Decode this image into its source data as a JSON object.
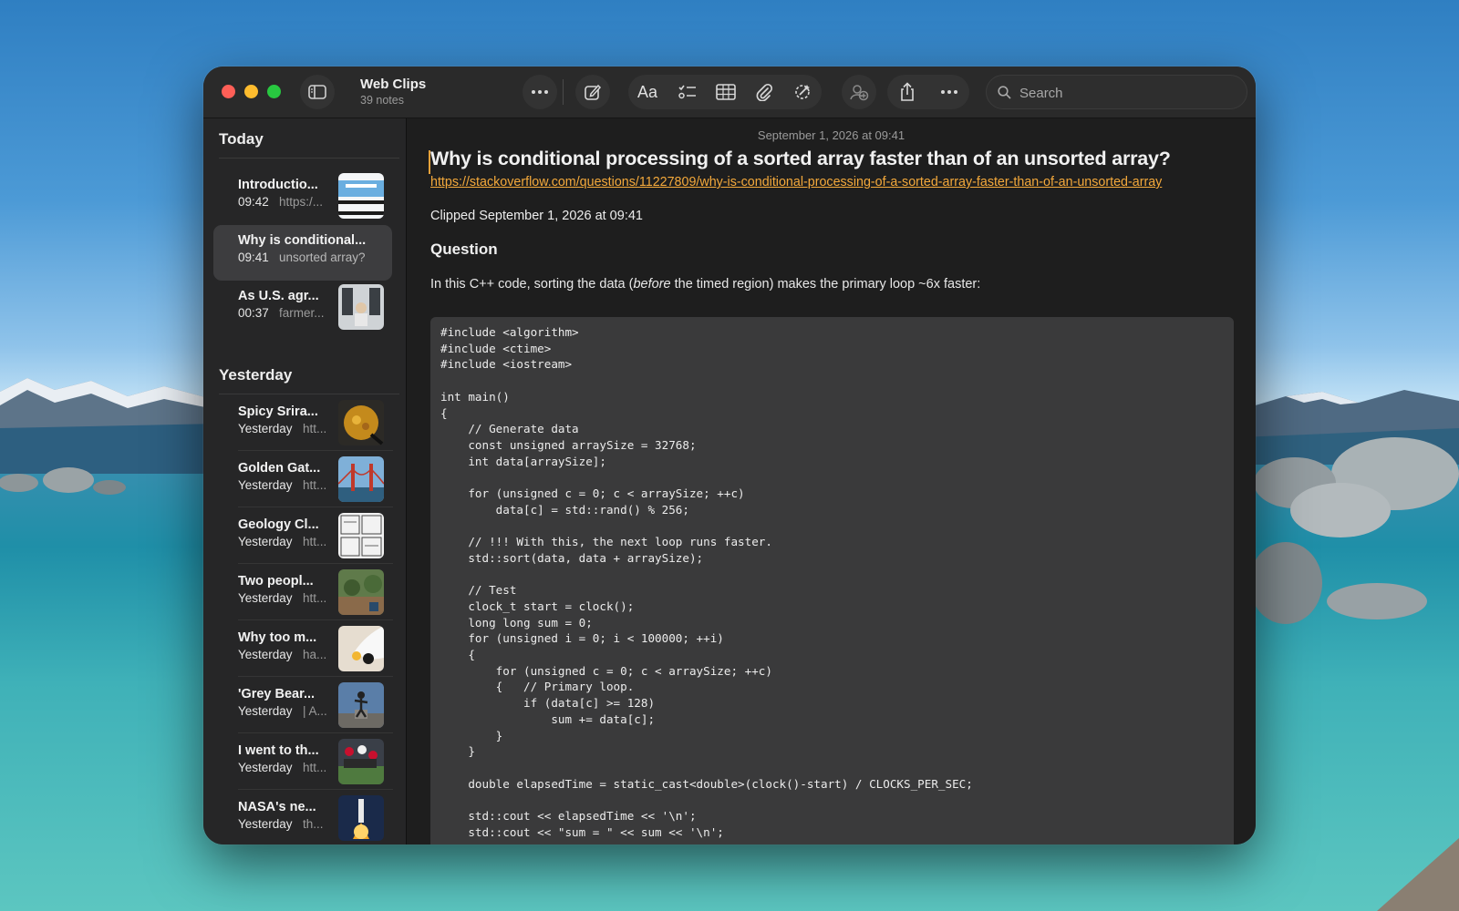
{
  "toolbar": {
    "folder_title": "Web Clips",
    "folder_count": "39 notes",
    "search_placeholder": "Search"
  },
  "sidebar": {
    "sections": [
      {
        "heading": "Today"
      },
      {
        "heading": "Yesterday"
      }
    ],
    "today_items": [
      {
        "title": "Introductio...",
        "time": "09:42",
        "preview": "https:/..."
      },
      {
        "title": "Why is conditional...",
        "time": "09:41",
        "preview": "unsorted array?",
        "selected": true
      },
      {
        "title": "As U.S. agr...",
        "time": "00:37",
        "preview": "farmer..."
      }
    ],
    "yesterday_items": [
      {
        "title": "Spicy Srira...",
        "time": "Yesterday",
        "preview": "htt..."
      },
      {
        "title": "Golden Gat...",
        "time": "Yesterday",
        "preview": "htt..."
      },
      {
        "title": "Geology Cl...",
        "time": "Yesterday",
        "preview": "htt..."
      },
      {
        "title": "Two peopl...",
        "time": "Yesterday",
        "preview": "htt..."
      },
      {
        "title": "Why too m...",
        "time": "Yesterday",
        "preview": "ha..."
      },
      {
        "title": "'Grey Bear...",
        "time": "Yesterday",
        "preview": "| A..."
      },
      {
        "title": "I went to th...",
        "time": "Yesterday",
        "preview": "htt..."
      },
      {
        "title": "NASA's ne...",
        "time": "Yesterday",
        "preview": "th..."
      }
    ]
  },
  "note": {
    "date": "September 1, 2026 at 09:41",
    "title": "Why is conditional processing of a sorted array faster than of an unsorted array?",
    "link": "https://stackoverflow.com/questions/11227809/why-is-conditional-processing-of-a-sorted-array-faster-than-of-an-unsorted-array",
    "clipped": "Clipped September 1, 2026 at 09:41",
    "question_heading": "Question",
    "para_before": "In this C++ code, sorting the data (",
    "para_em": "before",
    "para_after": " the timed region) makes the primary loop ~6x faster:",
    "code": "#include <algorithm>\n#include <ctime>\n#include <iostream>\n\nint main()\n{\n    // Generate data\n    const unsigned arraySize = 32768;\n    int data[arraySize];\n\n    for (unsigned c = 0; c < arraySize; ++c)\n        data[c] = std::rand() % 256;\n\n    // !!! With this, the next loop runs faster.\n    std::sort(data, data + arraySize);\n\n    // Test\n    clock_t start = clock();\n    long long sum = 0;\n    for (unsigned i = 0; i < 100000; ++i)\n    {\n        for (unsigned c = 0; c < arraySize; ++c)\n        {   // Primary loop.\n            if (data[c] >= 128)\n                sum += data[c];\n        }\n    }\n\n    double elapsedTime = static_cast<double>(clock()-start) / CLOCKS_PER_SEC;\n\n    std::cout << elapsedTime << '\\n';\n    std::cout << \"sum = \" << sum << '\\n';"
  },
  "icons": {
    "sidebar_toggle": "sidebar-toggle-icon",
    "more": "ellipsis-icon",
    "compose": "compose-icon",
    "format": "text-format-icon",
    "checklist": "checklist-icon",
    "table": "table-icon",
    "attach": "paperclip-icon",
    "writing_tools": "writing-tools-icon",
    "collab": "collaborate-icon",
    "share": "share-icon",
    "search": "search-icon"
  },
  "colors": {
    "accent_link": "#f4a93b",
    "close": "#ff5f57",
    "minimize": "#febc2e",
    "maximize": "#28c840"
  }
}
